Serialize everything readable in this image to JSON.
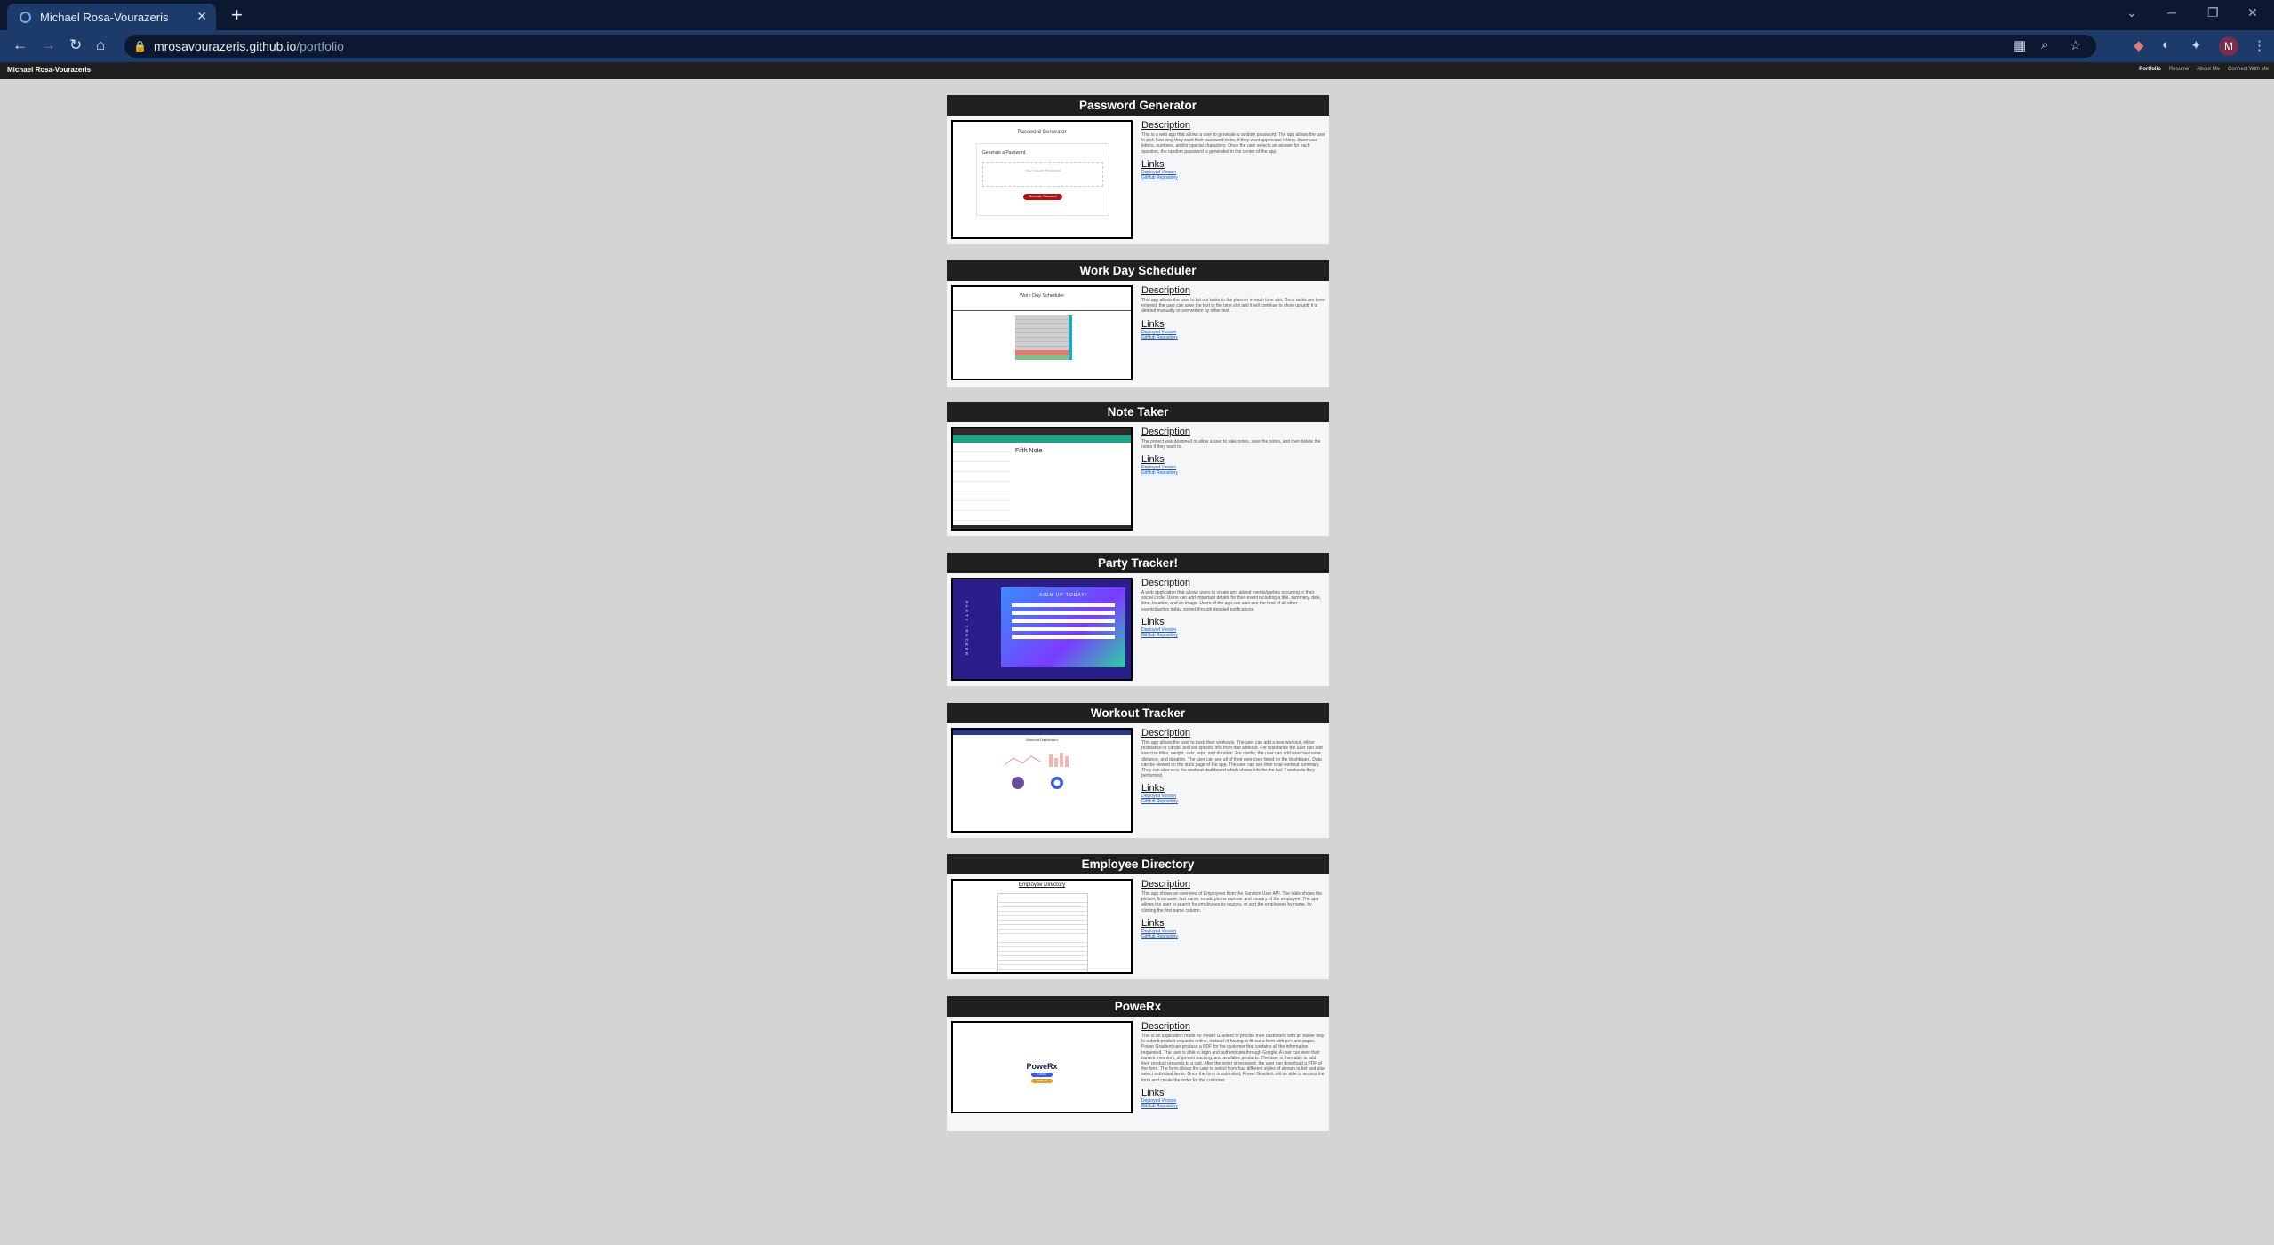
{
  "browser": {
    "tab_title": "Michael Rosa-Vourazeris",
    "new_tab": "+",
    "close": "✕",
    "url_host": "mrosavourazeris.github.io",
    "url_path": "/portfolio",
    "profile_initial": "M"
  },
  "site": {
    "brand": "Michael Rosa-Vourazeris",
    "nav": [
      "Portfolio",
      "Resume",
      "About Me",
      "Connect With Me"
    ]
  },
  "projects": [
    {
      "title": "Password Generator",
      "desc_heading": "Description",
      "links_heading": "Links",
      "description": "This is a web app that allows a user to generate a random password. The app allows the user to pick how long they want their password to be, if they want uppercase letters, lowercase letters, numbers, and/or special characters. Once the user selects an answer for each question, the random password is generated in the center of the app.",
      "links": [
        "Deployed Version",
        "GitHub Repository"
      ],
      "thumb": {
        "title": "Password Generator",
        "sub": "Generate a Password",
        "placeholder": "Your Secure Password",
        "button": "Generate Password"
      }
    },
    {
      "title": "Work Day Scheduler",
      "desc_heading": "Description",
      "links_heading": "Links",
      "description": "This app allows the user to list out tasks to the planner in each time slot. Once tasks are been entered, the user can save the text to the time slot and it will continue to show up until it is deleted manually or overwritten by other text.",
      "links": [
        "Deployed Version",
        "GitHub Repository"
      ],
      "thumb": {
        "title": "Work Day Scheduler"
      }
    },
    {
      "title": "Note Taker",
      "desc_heading": "Description",
      "links_heading": "Links",
      "description": "The project was designed to allow a user to take notes, save the notes, and then delete the notes if they want to.",
      "links": [
        "Deployed Version",
        "GitHub Repository"
      ],
      "thumb": {
        "note": "Fifth Note"
      }
    },
    {
      "title": "Party Tracker!",
      "desc_heading": "Description",
      "links_heading": "Links",
      "description": "A web application that allows users to create and attend events/parties occurring in their social circle. Users can add important details for their event including a title, summary, date, time, location, and an image. Users of the app can also see the host of all other events/parties today, sorted through detailed notifications.",
      "links": [
        "Deployed Version",
        "GitHub Repository"
      ],
      "thumb": {
        "heading": "SIGN UP TODAY!",
        "side": "PARTY TRACKER"
      }
    },
    {
      "title": "Workout Tracker",
      "desc_heading": "Description",
      "links_heading": "Links",
      "description": "This app allows the user to track their workouts. The user can add a new workout, either resistance or cardio, and will specific info from that workout. For resistance the user can add exercise titles, weight, sets, reps, and duration. For cardio, the user can add exercise name, distance, and duration. The user can see all of their exercises listed on the dashboard. Data can be viewed on the stats page of the app. The user can see their total workout summary. They can also view the workout dashboard which shows info for the last 7 workouts they performed.",
      "links": [
        "Deployed Version",
        "GitHub Repository"
      ],
      "thumb": {
        "title": "Workout Dashboard"
      }
    },
    {
      "title": "Employee Directory",
      "desc_heading": "Description",
      "links_heading": "Links",
      "description": "This app shows an overview of Employees from the Random User API. The table shows the picture, first name, last name, email, phone number and country of the employee. The app allows the user to search for employees by country, or sort the employees by name, by clicking the first name column.",
      "links": [
        "Deployed Version",
        "GitHub Repository"
      ],
      "thumb": {
        "title": "Employee Directory"
      }
    },
    {
      "title": "PoweRx",
      "desc_heading": "Description",
      "links_heading": "Links",
      "description": "This is an application made for Power Gradient to provide their customers with an easier way to submit product requests online. Instead of having to fill out a form with pen and paper, Power Gradient can produce a PDF for the customer that contains all the information requested. The user is able to login and authenticate through Google. A user can view their current inventory, shipment tracking, and available products. The user is then able to add their product requests to a cart. After the order is reviewed, the user can download a PDF of the form. The form allows the user to select from four different styles of stream outlet and also select individual items. Once the form is submitted, Power Gradient will be able to access the form and create the order for the customer.",
      "links": [
        "Deployed Version",
        "GitHub Repository"
      ],
      "thumb": {
        "title": "PoweRx",
        "btn1": "LOGIN",
        "btn2": "SIGN UP"
      }
    }
  ]
}
